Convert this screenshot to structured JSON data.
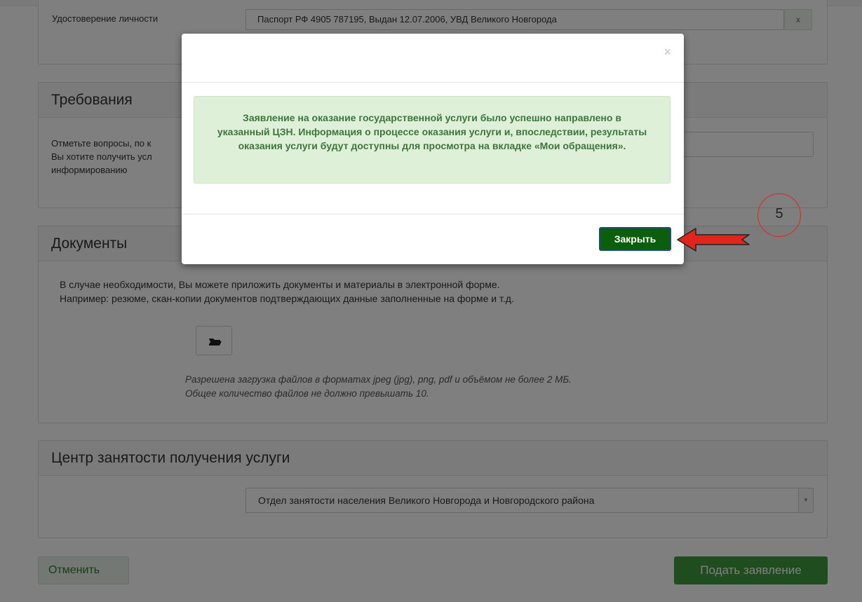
{
  "identity": {
    "label": "Удостоверение личности",
    "value": "Паспорт РФ 4905 787195, Выдан 12.07.2006, УВД Великого Новгорода",
    "remove_label": "x"
  },
  "requirements": {
    "title": "Требования",
    "text_line1": "Отметьте вопросы, по к",
    "text_line2": "Вы хотите получить усл",
    "text_line3": "информированию"
  },
  "documents": {
    "title": "Документы",
    "line1": "В случае необходимости, Вы можете приложить документы и материалы в электронной форме.",
    "line2": "Например: резюме, скан-копии документов подтверждающих данные заполненные на форме и т.д.",
    "note1": "Разрешена загрузка файлов в форматах jpeg (jpg), png, pdf и объёмом не более 2 МБ.",
    "note2": "Общее количество файлов не должно превышать 10.",
    "upload_icon": "folder-open-icon"
  },
  "center": {
    "title": "Центр занятости получения услуги",
    "selected": "Отдел занятости населения Великого Новгорода и Новгородского района"
  },
  "actions": {
    "cancel": "Отменить",
    "submit": "Подать заявление"
  },
  "modal": {
    "close_glyph": "×",
    "message": "Заявление на оказание государственной услуги было успешно направлено в указанный ЦЗН. Информация о процессе оказания услуги и, впоследствии, результаты оказания услуги будут доступны для просмотра на вкладке «Мои обращения».",
    "close_button": "Закрыть"
  },
  "annotation": {
    "step": "5",
    "color": "#e2241f"
  }
}
